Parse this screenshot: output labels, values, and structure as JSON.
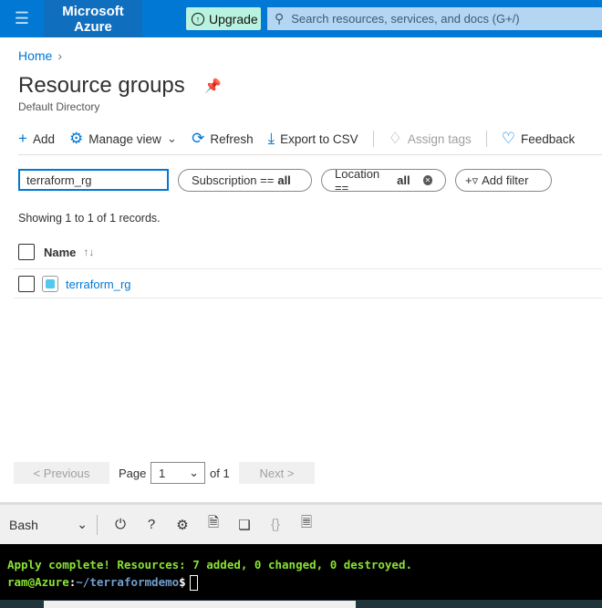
{
  "topbar": {
    "menu_icon": "hamburger-icon",
    "brand": "Microsoft Azure",
    "upgrade": "Upgrade",
    "search_placeholder": "Search resources, services, and docs (G+/)"
  },
  "breadcrumb": {
    "home": "Home"
  },
  "page": {
    "title": "Resource groups",
    "subtitle": "Default Directory"
  },
  "toolbar": {
    "add": "Add",
    "manage_view": "Manage view",
    "refresh": "Refresh",
    "export": "Export to CSV",
    "assign_tags": "Assign tags",
    "feedback": "Feedback"
  },
  "filters": {
    "name_value": "terraform_rg",
    "subscription_label": "Subscription ==",
    "subscription_value": "all",
    "location_label": "Location ==",
    "location_value": "all",
    "add_filter": "Add filter"
  },
  "records": "Showing 1 to 1 of 1 records.",
  "table": {
    "columns": [
      "Name"
    ],
    "rows": [
      {
        "name": "terraform_rg"
      }
    ]
  },
  "pager": {
    "previous": "< Previous",
    "page_label": "Page",
    "page_value": "1",
    "of": "of 1",
    "next": "Next >"
  },
  "shell": {
    "type": "Bash",
    "line1": "Apply complete! Resources: 7 added, 0 changed, 0 destroyed.",
    "prompt_user": "ram@Azure",
    "prompt_colon": ":",
    "prompt_path": "~/terraformdemo",
    "prompt_sign": "$"
  }
}
